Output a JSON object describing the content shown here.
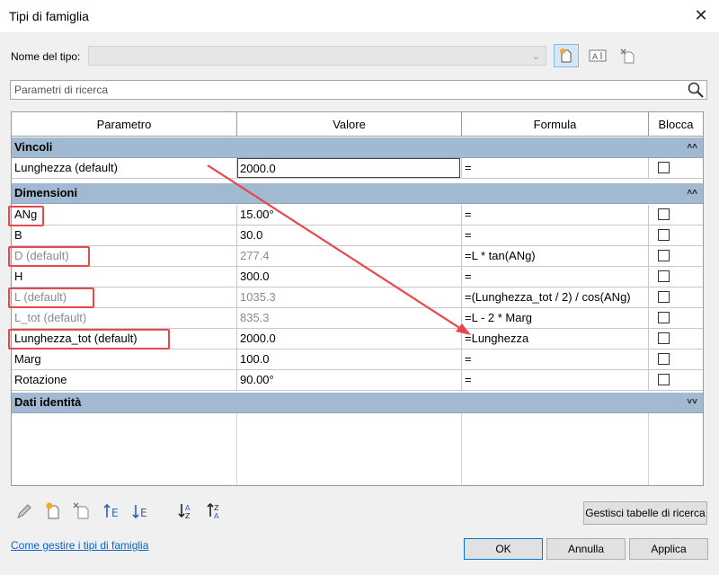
{
  "window": {
    "title": "Tipi di famiglia"
  },
  "type_row": {
    "label": "Nome del tipo:",
    "value": ""
  },
  "search": {
    "placeholder": "Parametri di ricerca"
  },
  "columns": [
    "Parametro",
    "Valore",
    "Formula",
    "Blocca"
  ],
  "groups": {
    "vincoli": "Vincoli",
    "dimensioni": "Dimensioni",
    "dati": "Dati identità"
  },
  "rows": [
    {
      "name": "Lunghezza (default)",
      "value": "2000.0",
      "formula": "=",
      "locked": false
    },
    {
      "name": "ANg",
      "value": "15.00°",
      "formula": "=",
      "locked": false
    },
    {
      "name": "B",
      "value": "30.0",
      "formula": "=",
      "locked": false
    },
    {
      "name": "D (default)",
      "value": "277.4",
      "formula": "=L * tan(ANg)",
      "locked": false
    },
    {
      "name": "H",
      "value": "300.0",
      "formula": "=",
      "locked": false
    },
    {
      "name": "L (default)",
      "value": "1035.3",
      "formula": "=(Lunghezza_tot / 2) / cos(ANg)",
      "locked": false
    },
    {
      "name": "L_tot (default)",
      "value": "835.3",
      "formula": "=L - 2 * Marg",
      "locked": false
    },
    {
      "name": "Lunghezza_tot (default)",
      "value": "2000.0",
      "formula": "=Lunghezza",
      "locked": false
    },
    {
      "name": "Marg",
      "value": "100.0",
      "formula": "=",
      "locked": false
    },
    {
      "name": "Rotazione",
      "value": "90.00°",
      "formula": "=",
      "locked": false
    }
  ],
  "buttons": {
    "lookup": "Gestisci tabelle di ricerca",
    "ok": "OK",
    "cancel": "Annulla",
    "apply": "Applica"
  },
  "help_link": "Come gestire i tipi di famiglia",
  "colors": {
    "group_header": "#a2b9d2",
    "highlight": "#e8474c",
    "link": "#0a63c9"
  },
  "icons": [
    "close-icon",
    "new-type-icon",
    "rename-type-icon",
    "delete-type-icon",
    "search-icon",
    "edit-parameter-icon",
    "new-parameter-icon",
    "delete-parameter-icon",
    "move-up-icon",
    "move-down-icon",
    "sort-ascending-icon",
    "sort-descending-icon"
  ]
}
